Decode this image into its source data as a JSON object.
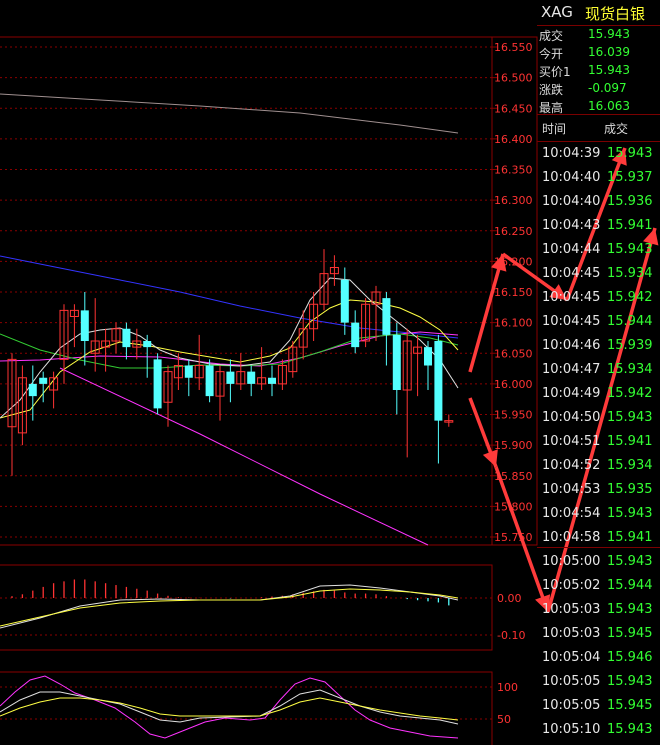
{
  "header": {
    "code": "XAG",
    "name": "现货白银"
  },
  "quote": [
    {
      "label": "成交",
      "value": "15.943",
      "color": "#33ff33"
    },
    {
      "label": "今开",
      "value": "16.039",
      "color": "#33ff33"
    },
    {
      "label": "买价1",
      "value": "15.943",
      "color": "#33ff33"
    },
    {
      "label": "涨跌",
      "value": "-0.097",
      "color": "#33ff33"
    },
    {
      "label": "最高",
      "value": "16.063",
      "color": "#33ff33"
    }
  ],
  "ticks_header": {
    "time": "时间",
    "price": "成交"
  },
  "ticks": [
    {
      "time": "10:04:39",
      "price": "15.943"
    },
    {
      "time": "10:04:40",
      "price": "15.937"
    },
    {
      "time": "10:04:40",
      "price": "15.936"
    },
    {
      "time": "10:04:43",
      "price": "15.941"
    },
    {
      "time": "10:04:44",
      "price": "15.943"
    },
    {
      "time": "10:04:45",
      "price": "15.934"
    },
    {
      "time": "10:04:45",
      "price": "15.942"
    },
    {
      "time": "10:04:45",
      "price": "15.944"
    },
    {
      "time": "10:04:46",
      "price": "15.939"
    },
    {
      "time": "10:04:47",
      "price": "15.934"
    },
    {
      "time": "10:04:49",
      "price": "15.942"
    },
    {
      "time": "10:04:50",
      "price": "15.943"
    },
    {
      "time": "10:04:51",
      "price": "15.941"
    },
    {
      "time": "10:04:52",
      "price": "15.934"
    },
    {
      "time": "10:04:53",
      "price": "15.935"
    },
    {
      "time": "10:04:54",
      "price": "15.943"
    },
    {
      "time": "10:04:58",
      "price": "15.941"
    },
    {
      "time": "10:05:00",
      "price": "15.943"
    },
    {
      "time": "10:05:02",
      "price": "15.944"
    },
    {
      "time": "10:05:03",
      "price": "15.943"
    },
    {
      "time": "10:05:03",
      "price": "15.945"
    },
    {
      "time": "10:05:04",
      "price": "15.946"
    },
    {
      "time": "10:05:05",
      "price": "15.943"
    },
    {
      "time": "10:05:05",
      "price": "15.945"
    },
    {
      "time": "10:05:10",
      "price": "15.943"
    }
  ],
  "colors": {
    "up": "#ff3333",
    "down": "#54ffff",
    "grid": "#8a0000",
    "axis_text": "#ff3333",
    "ma_white": "#e0e0e0",
    "ma_yellow": "#ffff44",
    "ma_green": "#33cc33",
    "ma_magenta": "#ff33ff",
    "ma_blue": "#3333ff",
    "ma_gray": "#a09090",
    "arrow": "#ff3b3b"
  },
  "chart_data": [
    {
      "type": "candlestick",
      "ylim": [
        15.73,
        16.57
      ],
      "yticks": [
        "16.550",
        "16.500",
        "16.450",
        "16.400",
        "16.350",
        "16.300",
        "16.250",
        "16.200",
        "16.150",
        "16.100",
        "16.050",
        "16.000",
        "15.950",
        "15.900",
        "15.850",
        "15.800",
        "15.750"
      ],
      "candles": [
        {
          "o": 15.93,
          "c": 16.04,
          "h": 16.05,
          "l": 15.85
        },
        {
          "o": 15.92,
          "c": 16.01,
          "h": 16.03,
          "l": 15.9
        },
        {
          "o": 16.0,
          "c": 15.98,
          "h": 16.03,
          "l": 15.94
        },
        {
          "o": 16.01,
          "c": 16.0,
          "h": 16.02,
          "l": 15.97
        },
        {
          "o": 15.99,
          "c": 16.01,
          "h": 16.02,
          "l": 15.96
        },
        {
          "o": 16.04,
          "c": 16.12,
          "h": 16.13,
          "l": 16.0
        },
        {
          "o": 16.11,
          "c": 16.12,
          "h": 16.13,
          "l": 16.06
        },
        {
          "o": 16.12,
          "c": 16.07,
          "h": 16.15,
          "l": 16.03
        },
        {
          "o": 16.05,
          "c": 16.07,
          "h": 16.14,
          "l": 16.02
        },
        {
          "o": 16.06,
          "c": 16.07,
          "h": 16.09,
          "l": 16.02
        },
        {
          "o": 16.07,
          "c": 16.09,
          "h": 16.1,
          "l": 16.05
        },
        {
          "o": 16.09,
          "c": 16.06,
          "h": 16.1,
          "l": 16.04
        },
        {
          "o": 16.06,
          "c": 16.07,
          "h": 16.09,
          "l": 16.04
        },
        {
          "o": 16.07,
          "c": 16.06,
          "h": 16.08,
          "l": 16.01
        },
        {
          "o": 16.04,
          "c": 15.96,
          "h": 16.05,
          "l": 15.95
        },
        {
          "o": 15.97,
          "c": 16.02,
          "h": 16.03,
          "l": 15.93
        },
        {
          "o": 16.01,
          "c": 16.03,
          "h": 16.05,
          "l": 15.99
        },
        {
          "o": 16.03,
          "c": 16.01,
          "h": 16.04,
          "l": 15.98
        },
        {
          "o": 16.01,
          "c": 16.03,
          "h": 16.08,
          "l": 15.99
        },
        {
          "o": 16.03,
          "c": 15.98,
          "h": 16.04,
          "l": 15.97
        },
        {
          "o": 15.98,
          "c": 16.02,
          "h": 16.03,
          "l": 15.94
        },
        {
          "o": 16.02,
          "c": 16.0,
          "h": 16.04,
          "l": 15.97
        },
        {
          "o": 16.0,
          "c": 16.02,
          "h": 16.05,
          "l": 15.99
        },
        {
          "o": 16.02,
          "c": 16.0,
          "h": 16.03,
          "l": 15.98
        },
        {
          "o": 16.0,
          "c": 16.01,
          "h": 16.06,
          "l": 15.99
        },
        {
          "o": 16.01,
          "c": 16.0,
          "h": 16.03,
          "l": 15.98
        },
        {
          "o": 16.0,
          "c": 16.03,
          "h": 16.04,
          "l": 15.99
        },
        {
          "o": 16.02,
          "c": 16.06,
          "h": 16.07,
          "l": 16.01
        },
        {
          "o": 16.06,
          "c": 16.09,
          "h": 16.12,
          "l": 16.04
        },
        {
          "o": 16.09,
          "c": 16.13,
          "h": 16.15,
          "l": 16.07
        },
        {
          "o": 16.13,
          "c": 16.18,
          "h": 16.22,
          "l": 16.12
        },
        {
          "o": 16.18,
          "c": 16.19,
          "h": 16.21,
          "l": 16.16
        },
        {
          "o": 16.17,
          "c": 16.1,
          "h": 16.19,
          "l": 16.08
        },
        {
          "o": 16.1,
          "c": 16.06,
          "h": 16.12,
          "l": 16.05
        },
        {
          "o": 16.07,
          "c": 16.13,
          "h": 16.14,
          "l": 16.06
        },
        {
          "o": 16.13,
          "c": 16.15,
          "h": 16.16,
          "l": 16.07
        },
        {
          "o": 16.14,
          "c": 16.08,
          "h": 16.15,
          "l": 16.03
        },
        {
          "o": 16.08,
          "c": 15.99,
          "h": 16.1,
          "l": 15.95
        },
        {
          "o": 15.99,
          "c": 16.07,
          "h": 16.09,
          "l": 15.88
        },
        {
          "o": 16.05,
          "c": 16.06,
          "h": 16.08,
          "l": 15.98
        },
        {
          "o": 16.06,
          "c": 16.03,
          "h": 16.07,
          "l": 15.99
        },
        {
          "o": 16.07,
          "c": 15.94,
          "h": 16.08,
          "l": 15.87
        },
        {
          "o": 15.94,
          "c": 15.94,
          "h": 15.95,
          "l": 15.93
        }
      ]
    },
    {
      "type": "bar",
      "yticks": [
        "0.00",
        "-0.10"
      ],
      "ylim": [
        -0.16,
        0.12
      ]
    },
    {
      "type": "line",
      "yticks": [
        "100",
        "50"
      ],
      "ylim": [
        20,
        115
      ]
    }
  ]
}
